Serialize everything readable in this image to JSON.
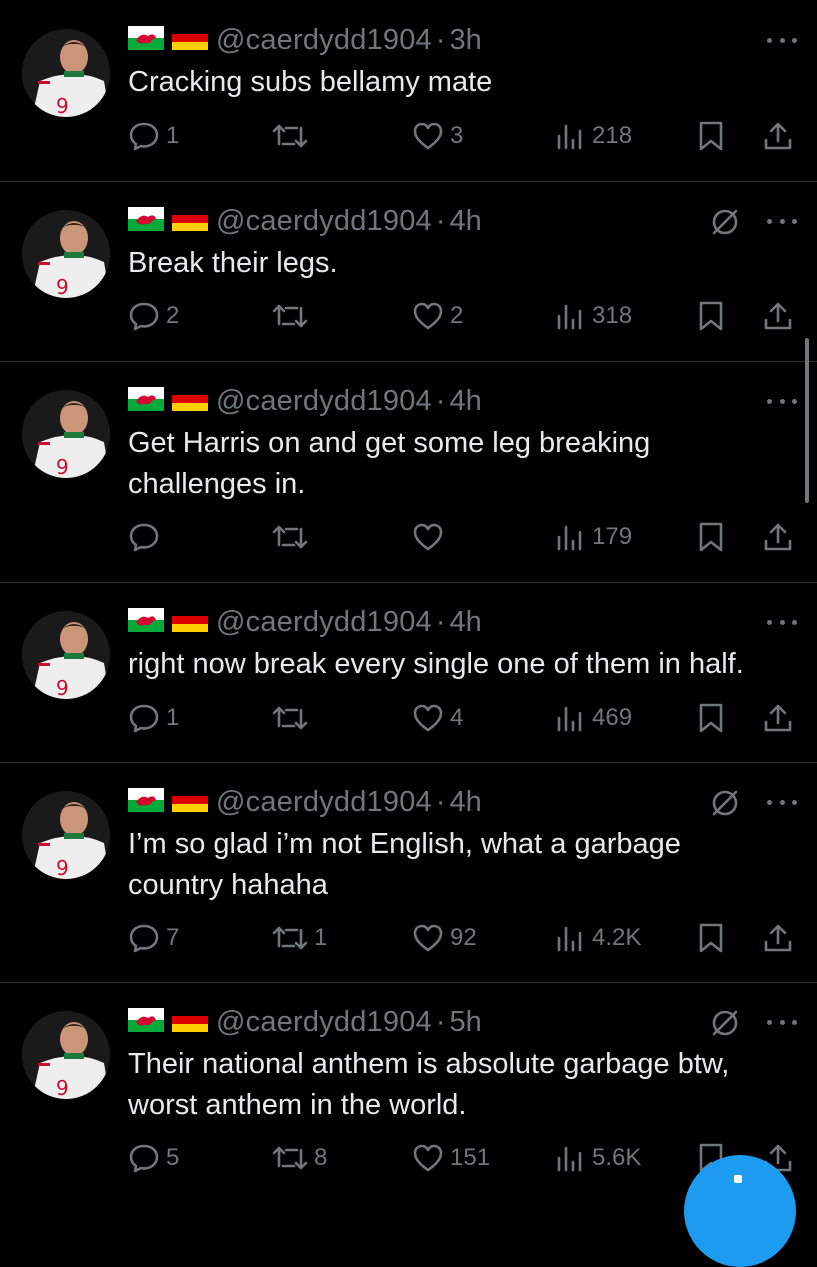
{
  "tweets": [
    {
      "handle": "@caerdydd1904",
      "separator": "·",
      "time": "3h",
      "text": "Cracking subs bellamy mate",
      "replies": "1",
      "retweets": "",
      "likes": "3",
      "views": "218",
      "blocked_icon": false
    },
    {
      "handle": "@caerdydd1904",
      "separator": "·",
      "time": "4h",
      "text": "Break their legs.",
      "replies": "2",
      "retweets": "",
      "likes": "2",
      "views": "318",
      "blocked_icon": true
    },
    {
      "handle": "@caerdydd1904",
      "separator": "·",
      "time": "4h",
      "text": "Get Harris on and get some leg breaking\nchallenges in.",
      "replies": "",
      "retweets": "",
      "likes": "",
      "views": "179",
      "blocked_icon": false
    },
    {
      "handle": "@caerdydd1904",
      "separator": "·",
      "time": "4h",
      "text": "right now break every single one of them in half.",
      "replies": "1",
      "retweets": "",
      "likes": "4",
      "views": "469",
      "blocked_icon": false
    },
    {
      "handle": "@caerdydd1904",
      "separator": "·",
      "time": "4h",
      "text": "I’m so glad i’m not English, what a garbage\ncountry hahaha",
      "replies": "7",
      "retweets": "1",
      "likes": "92",
      "views": "4.2K",
      "blocked_icon": true
    },
    {
      "handle": "@caerdydd1904",
      "separator": "·",
      "time": "5h",
      "text": "Their national anthem is absolute garbage btw,\nworst anthem in the world.",
      "replies": "5",
      "retweets": "8",
      "likes": "151",
      "views": "5.6K",
      "blocked_icon": true
    }
  ],
  "colors": {
    "background": "#000000",
    "text": "#e7e9ea",
    "muted": "#71767b",
    "divider": "#2f3336",
    "accent": "#1d9bf0"
  },
  "icons": [
    "wales-flag-icon",
    "germany-flag-icon",
    "more-icon",
    "block-icon",
    "reply-icon",
    "retweet-icon",
    "like-icon",
    "views-icon",
    "bookmark-icon",
    "share-icon",
    "compose-fab"
  ]
}
